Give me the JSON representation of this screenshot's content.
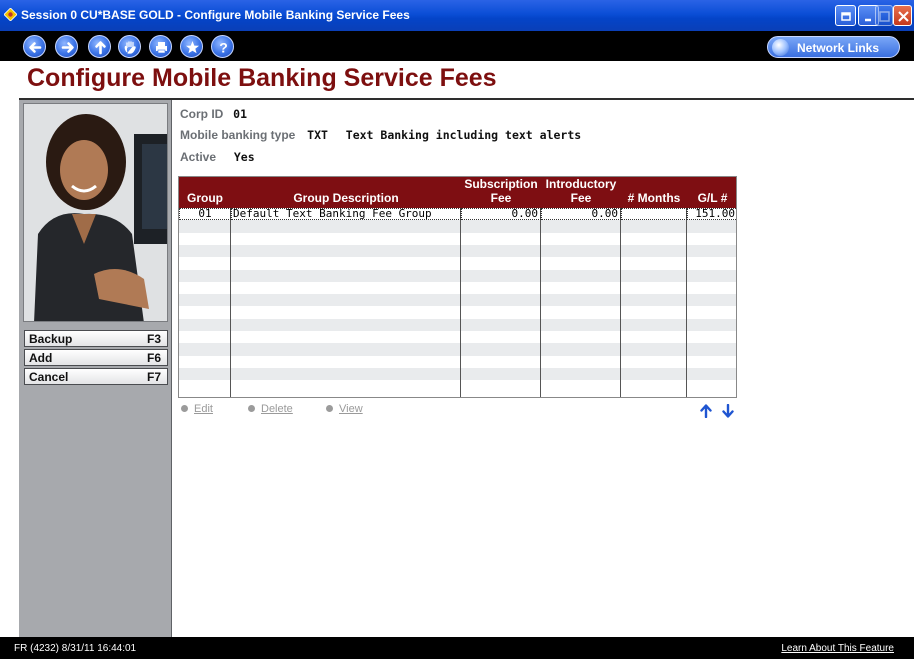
{
  "window": {
    "title": "Session 0 CU*BASE GOLD - Configure Mobile Banking Service Fees"
  },
  "toolbar": {
    "icons": [
      "back-icon",
      "forward-icon",
      "up-icon",
      "hand-icon",
      "print-icon",
      "star-icon",
      "help-icon"
    ],
    "network_links": "Network Links"
  },
  "page": {
    "title": "Configure Mobile Banking Service Fees"
  },
  "fkeys": [
    {
      "label": "Backup",
      "key": "F3"
    },
    {
      "label": "Add",
      "key": "F6"
    },
    {
      "label": "Cancel",
      "key": "F7"
    }
  ],
  "info": {
    "corp_label": "Corp ID",
    "corp_value": "01",
    "type_label": "Mobile banking type",
    "type_code": "TXT",
    "type_desc": "Text Banking including text alerts",
    "active_label": "Active",
    "active_value": "Yes"
  },
  "grid": {
    "headers": {
      "group": "Group",
      "description": "Group Description",
      "subscription_1": "Subscription",
      "subscription_2": "Fee",
      "intro_1": "Introductory",
      "intro_2": "Fee",
      "months": "# Months",
      "gl": "G/L #"
    },
    "rows": [
      {
        "group": "01",
        "description": "Default Text Banking Fee Group",
        "subscription_fee": "0.00",
        "intro_fee": "0.00",
        "months": "",
        "gl": "151.00"
      }
    ]
  },
  "actions": {
    "edit": "Edit",
    "delete": "Delete",
    "view": "View"
  },
  "footer": {
    "status": "FR (4232) 8/31/11 16:44:01",
    "learn": "Learn About This Feature"
  }
}
